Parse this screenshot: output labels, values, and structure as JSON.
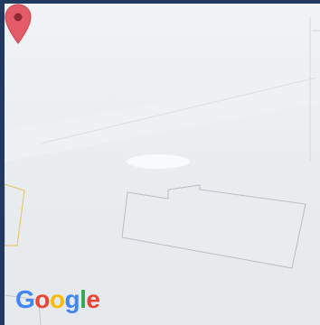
{
  "map": {
    "attribution_logo": {
      "text": "Google",
      "letters": [
        {
          "ch": "G",
          "color": "#4285F4"
        },
        {
          "ch": "o",
          "color": "#EA4335"
        },
        {
          "ch": "o",
          "color": "#FBBC05"
        },
        {
          "ch": "g",
          "color": "#4285F4"
        },
        {
          "ch": "l",
          "color": "#34A853"
        },
        {
          "ch": "e",
          "color": "#EA4335"
        }
      ]
    },
    "marker": {
      "icon": "map-pin-icon",
      "color": "#E35B66"
    },
    "colors": {
      "background": "#EDEFF2",
      "building_outline": "#B9BDC3",
      "road_outline": "#E8C77A",
      "frame": "#23385E"
    }
  }
}
